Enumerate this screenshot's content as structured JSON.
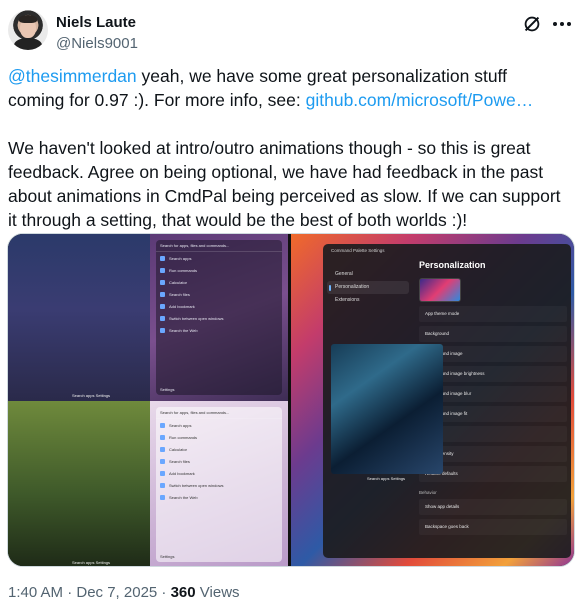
{
  "author": {
    "name": "Niels Laute",
    "handle": "@Niels9001"
  },
  "tweet": {
    "mention": "@thesimmerdan",
    "line1_rest": " yeah, we have some great personalization stuff coming for 0.97 :). For more info, see: ",
    "link": "github.com/microsoft/Powe…",
    "paragraph2": "We haven't looked at intro/outro animations though - so this is great feedback. Agree on being optional, we have had feedback in the past about animations in CmdPal being perceived as slow. If we can support it through a setting, that would be the best of both worlds :)!"
  },
  "media": {
    "palette_top": {
      "search": "Search for apps, files and commands...",
      "items": [
        "Search apps",
        "Run commands",
        "Calculator",
        "Search files",
        "Add bookmark",
        "Switch between open windows",
        "Search the Web"
      ],
      "settings": "Settings"
    },
    "palette_bottom": {
      "search": "Search for apps, files and commands...",
      "items": [
        "Search apps",
        "Run commands",
        "Calculator",
        "Search files",
        "Add bookmark",
        "Switch between open windows",
        "Search the Web"
      ],
      "settings": "Settings"
    },
    "mini_bar": "Search apps   Settings",
    "settings_window": {
      "title": "Command Palette Settings",
      "nav": [
        "General",
        "Personalization",
        "Extensions"
      ],
      "heading": "Personalization",
      "rows": [
        "App theme mode",
        "Background",
        "Background image",
        "Background image brightness",
        "Background image blur",
        "Background image fit",
        "Color tint",
        "Color intensity",
        "Restore defaults"
      ],
      "section": "Behavior",
      "behavior_rows": [
        "Show app details",
        "Backspace goes back"
      ],
      "preview_search": "Search apps   Settings"
    }
  },
  "footer": {
    "time": "1:40 AM · Dec 7, 2025 · ",
    "views_count": "360",
    "views_label": " Views"
  }
}
